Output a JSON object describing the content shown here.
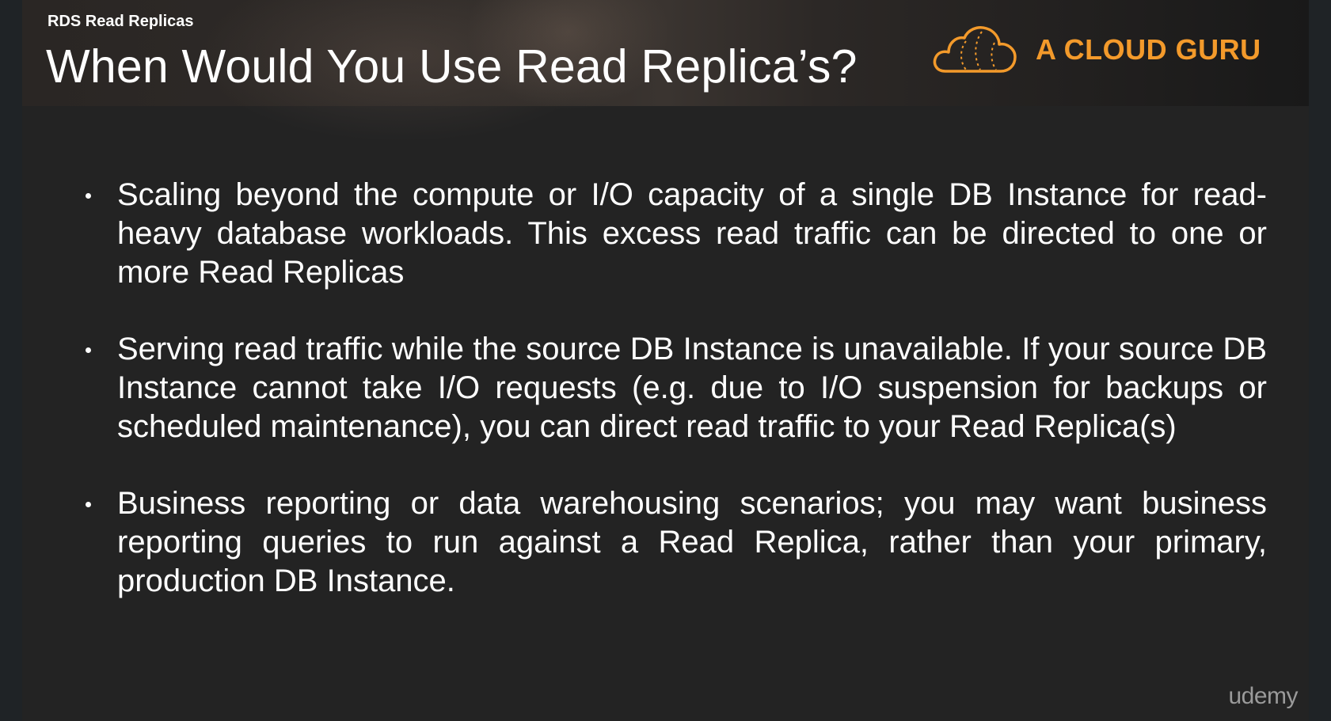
{
  "header": {
    "section_label": "RDS Read Replicas",
    "title": "When Would You Use Read Replica’s?",
    "brand": {
      "name": "A CLOUD GURU",
      "icon": "cloud-logo-icon",
      "color": "#f39a2b"
    }
  },
  "content": {
    "bullets": [
      "Scaling beyond the compute or I/O capacity of a single DB Instance for read-heavy database workloads. This excess read traffic can be directed to one or more Read Replicas",
      "Serving read traffic while the source DB Instance is unavailable. If your source DB Instance cannot take I/O requests (e.g. due to I/O suspension for backups or scheduled maintenance), you can direct read traffic to your Read Replica(s)",
      "Business reporting or data warehousing scenarios; you may want business reporting queries to run against a Read Replica, rather than your primary, production DB Instance."
    ]
  },
  "footer": {
    "watermark": "udemy"
  },
  "colors": {
    "background": "#232323",
    "text": "#ffffff",
    "accent": "#f39a2b"
  }
}
